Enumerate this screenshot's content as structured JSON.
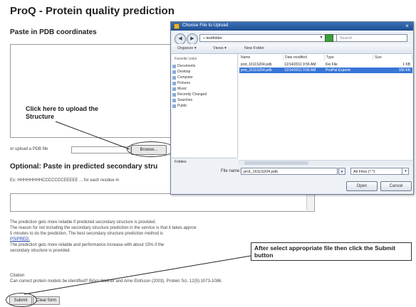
{
  "page": {
    "title": "ProQ - Protein quality prediction",
    "paste_label": "Paste in PDB coordinates",
    "upload_label": "or upload a PDB file",
    "browse_label": "Browse...",
    "optional_title": "Optional: Paste in predicted secondary stru",
    "example_text": "Ex: HHHHHHHHCCCCCCCEEEEE ... for each residue in",
    "paragraph_lines": [
      "The prediction gets more reliable if predicted secondary structure is provided.",
      "The reason for not including the secondary structure prediction in the service is that it takes approx",
      "5 minutes to do the prediction. The best secondary structure prediction method is",
      "PSIPRED.",
      "The prediction gets more reliable and performance increase with about 15% if the",
      "secondary structure is provided."
    ],
    "citation_label": "Citation",
    "citation_text": "Can correct protein models be identified? Björn Wallner and Arne Elofsson (2003). Protein Sci. 12(5):1073-1086.",
    "submit_label": "Submit",
    "clear_label": "Clear form"
  },
  "annotations": {
    "upload_callout": "Click here to upload the Structure",
    "submit_callout": "After select appropriate file then click the Submit button"
  },
  "dialog": {
    "title": "Choose File to Upload",
    "address": "« testfolder",
    "search_placeholder": "Search",
    "toolbar": {
      "organize": "Organize ▾",
      "views": "Views ▾",
      "new_folder": "New Folder"
    },
    "favorites": [
      "Favorite Links",
      "Documents",
      "Desktop",
      "Computer",
      "Pictures",
      "Music",
      "Recently Changed",
      "Searches",
      "Public"
    ],
    "folders_label": "Folders",
    "columns": [
      "Name",
      "Date modified",
      "Type",
      "Size"
    ],
    "files": [
      {
        "name": "prot_1611S204.pdb",
        "date": "12/14/2011 9:56 AM",
        "type": "Kei File",
        "size": "1 KB",
        "selected": false
      },
      {
        "name": "prot_1611S204.pdb",
        "date": "12/14/2011 9:56 AM",
        "type": "ProtPal Exporte",
        "size": "156 KB",
        "selected": true
      }
    ],
    "filename_label": "File name:",
    "filename_value": "prot_1611S204.pdb",
    "filetype_value": "All Files (*.*)",
    "open_label": "Open",
    "cancel_label": "Cancel",
    "close_glyph": "×"
  }
}
